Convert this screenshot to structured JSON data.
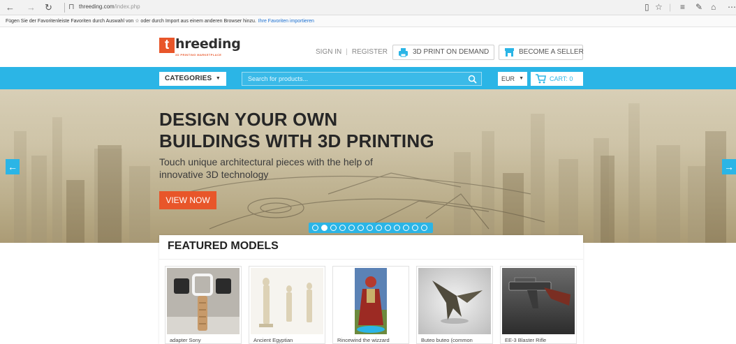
{
  "browser": {
    "url_host": "threeding.com",
    "url_path": "/index.php",
    "favorites_message": "Fügen Sie der Favoritenleiste Favoriten durch Auswahl von ☆ oder durch Import aus einem anderen Browser hinzu.",
    "favorites_link": "Ihre Favoriten importieren"
  },
  "header": {
    "logo_letter": "t",
    "logo_word": "hreeding",
    "logo_tagline": "3D PRINTING MARKETPLACE",
    "sign_in": "SIGN IN",
    "register": "REGISTER",
    "print_on_demand": "3D PRINT ON DEMAND",
    "become_seller": "BECOME A SELLER"
  },
  "nav": {
    "categories": "CATEGORIES",
    "search_placeholder": "Search for products...",
    "currency": "EUR",
    "cart": "CART: 0"
  },
  "hero": {
    "title_line1": "DESIGN YOUR OWN",
    "title_line2": "BUILDINGS WITH 3D PRINTING",
    "subtitle": "Touch unique architectural pieces with the help of innovative 3D technology",
    "cta": "VIEW NOW",
    "slide_count": 13,
    "active_slide": 2
  },
  "featured": {
    "title": "FEATURED MODELS",
    "items": [
      {
        "name": "adapter Sony"
      },
      {
        "name": "Ancient Egyptian"
      },
      {
        "name": "Rincewind the wizzard"
      },
      {
        "name": "Buteo buteo (common"
      },
      {
        "name": "EE-3 Blaster Rifle"
      }
    ]
  },
  "colors": {
    "accent_blue": "#2bb5e6",
    "accent_orange": "#e8562a"
  },
  "icons": [
    "back-icon",
    "forward-icon",
    "refresh-icon",
    "lock-icon",
    "reading-view-icon",
    "favorite-star-icon",
    "hub-icon",
    "web-note-icon",
    "share-icon",
    "more-icon",
    "print-icon",
    "seller-icon",
    "search-icon",
    "cart-icon",
    "arrow-left-icon",
    "arrow-right-icon"
  ]
}
